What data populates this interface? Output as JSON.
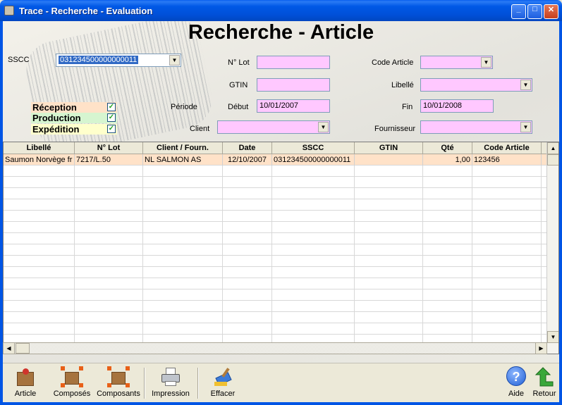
{
  "window": {
    "title": "Trace - Recherche - Evaluation"
  },
  "heading": "Recherche - Article",
  "filters": {
    "sscc_label": "SSCC",
    "sscc_value": "031234500000000011",
    "lot_label": "N° Lot",
    "lot_value": "",
    "gtin_label": "GTIN",
    "gtin_value": "",
    "code_article_label": "Code Article",
    "code_article_value": "",
    "libelle_label": "Libellé",
    "libelle_value": "",
    "periode_label": "Période",
    "debut_label": "Début",
    "debut_value": "10/01/2007",
    "fin_label": "Fin",
    "fin_value": "10/01/2008",
    "client_label": "Client",
    "client_value": "",
    "fournisseur_label": "Fournisseur",
    "fournisseur_value": ""
  },
  "checks": [
    {
      "label": "Réception",
      "checked": true,
      "color": "#FFE2C8"
    },
    {
      "label": "Production",
      "checked": true,
      "color": "#D6F5D0"
    },
    {
      "label": "Expédition",
      "checked": true,
      "color": "#FFFFCC"
    }
  ],
  "grid": {
    "columns": [
      "Libellé",
      "N° Lot",
      "Client / Fourn.",
      "Date",
      "SSCC",
      "GTIN",
      "Qté",
      "Code Article"
    ],
    "rows": [
      [
        "Saumon Norvège fr",
        "7217/L.50",
        "NL SALMON AS",
        "12/10/2007",
        "031234500000000011",
        "",
        "1,00",
        "123456"
      ]
    ]
  },
  "toolbar": {
    "article": "Article",
    "composes": "Composés",
    "composants": "Composants",
    "impression": "Impression",
    "effacer": "Effacer",
    "aide": "Aide",
    "retour": "Retour"
  },
  "colors": {
    "titlebar": "#0055E5",
    "field_bg": "#FFC8FF",
    "row_highlight": "#FFE2C8"
  }
}
